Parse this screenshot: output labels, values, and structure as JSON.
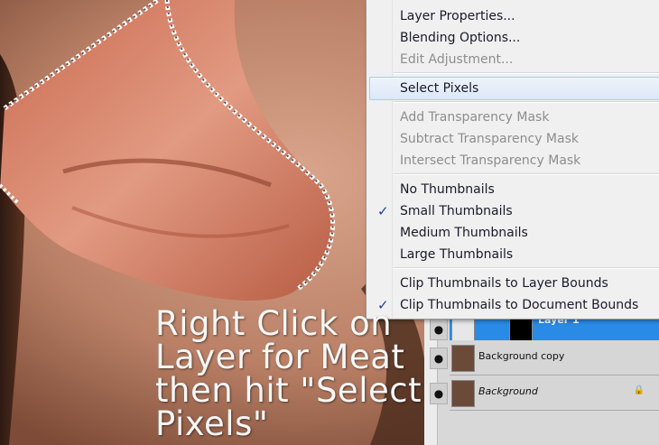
{
  "context_menu": {
    "items": [
      {
        "label": "Layer Properties...",
        "state": "enabled",
        "checked": false
      },
      {
        "label": "Blending Options...",
        "state": "enabled",
        "checked": false
      },
      {
        "label": "Edit Adjustment...",
        "state": "disabled",
        "checked": false
      },
      {
        "label": "Select Pixels",
        "state": "highlighted",
        "checked": false
      },
      {
        "label": "Add Transparency Mask",
        "state": "disabled",
        "checked": false
      },
      {
        "label": "Subtract Transparency Mask",
        "state": "disabled",
        "checked": false
      },
      {
        "label": "Intersect Transparency Mask",
        "state": "disabled",
        "checked": false
      },
      {
        "label": "No Thumbnails",
        "state": "enabled",
        "checked": false
      },
      {
        "label": "Small Thumbnails",
        "state": "enabled",
        "checked": true
      },
      {
        "label": "Medium Thumbnails",
        "state": "enabled",
        "checked": false
      },
      {
        "label": "Large Thumbnails",
        "state": "enabled",
        "checked": false
      },
      {
        "label": "Clip Thumbnails to Layer Bounds",
        "state": "enabled",
        "checked": false
      },
      {
        "label": "Clip Thumbnails to Document Bounds",
        "state": "enabled",
        "checked": true
      }
    ],
    "check_glyph": "✓"
  },
  "layers_panel": {
    "layers": [
      {
        "name": "Layer 1",
        "selected": true
      },
      {
        "name": "Background copy",
        "selected": false
      },
      {
        "name": "Background",
        "selected": false,
        "italic": true,
        "locked": true
      }
    ],
    "eye_glyph": "●",
    "lock_glyph": "🔒"
  },
  "caption": {
    "lines": [
      "Right Click on",
      "Layer for Meat",
      "then hit \"Select",
      "Pixels\""
    ]
  },
  "colors": {
    "selection": "#2a8be6",
    "menu_bg": "#f0f0f0",
    "meat": "#d8806a",
    "skin": "#c48a72"
  }
}
